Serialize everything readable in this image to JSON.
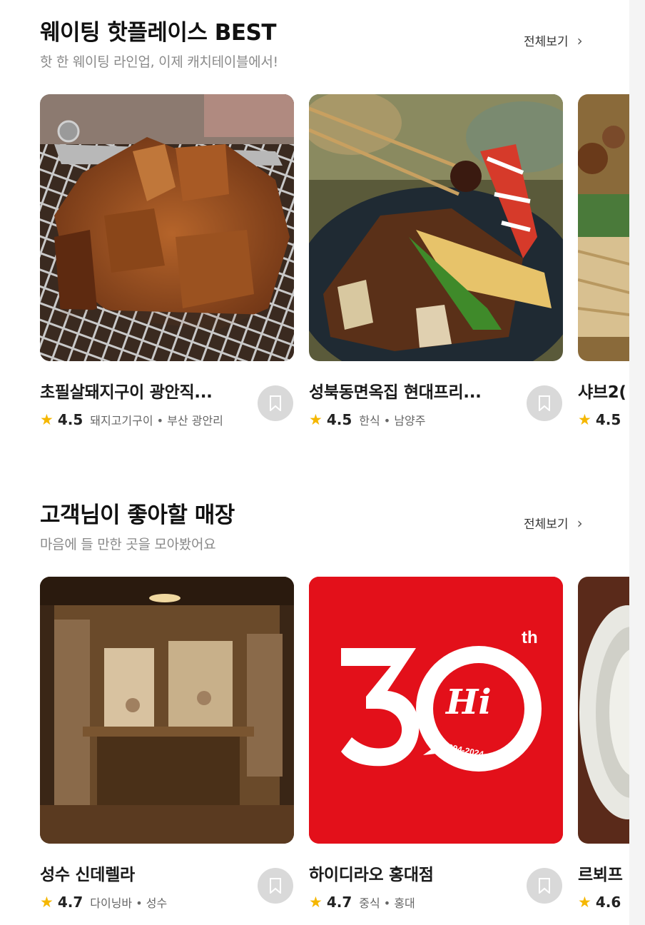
{
  "sections": [
    {
      "title": "웨이팅 핫플레이스 BEST",
      "subtitle": "핫 한 웨이팅 라인업, 이제 캐치테이블에서!",
      "see_all": "전체보기",
      "cards": [
        {
          "name": "초필살돼지구이 광안직...",
          "rating": "4.5",
          "category": "돼지고기구이 • 부산 광안리",
          "image": "grilled-pork-photo"
        },
        {
          "name": "성북동면옥집 현대프리...",
          "rating": "4.5",
          "category": "한식 • 남양주",
          "image": "galbi-skewer-photo"
        },
        {
          "name": "샤브2(",
          "rating": "4.5",
          "category": "",
          "image": "shabu-platter-photo"
        }
      ]
    },
    {
      "title": "고객님이 좋아할 매장",
      "subtitle": "마음에 들 만한 곳을 모아봤어요",
      "see_all": "전체보기",
      "cards": [
        {
          "name": "성수 신데렐라",
          "rating": "4.7",
          "category": "다이닝바 • 성수",
          "image": "bar-interior-photo"
        },
        {
          "name": "하이디라오 홍대점",
          "rating": "4.7",
          "category": "중식 • 홍대",
          "image": "haidilao-30th-logo",
          "logo_text": {
            "big": "30",
            "sup": "th",
            "script": "Hi",
            "years": "1994-2024"
          }
        },
        {
          "name": "르뵈프",
          "rating": "4.6",
          "category": "",
          "image": "plate-photo"
        }
      ]
    }
  ],
  "colors": {
    "star": "#f5b700",
    "logo_red": "#e3101a",
    "bookmark_bg": "#d9d9d9"
  }
}
